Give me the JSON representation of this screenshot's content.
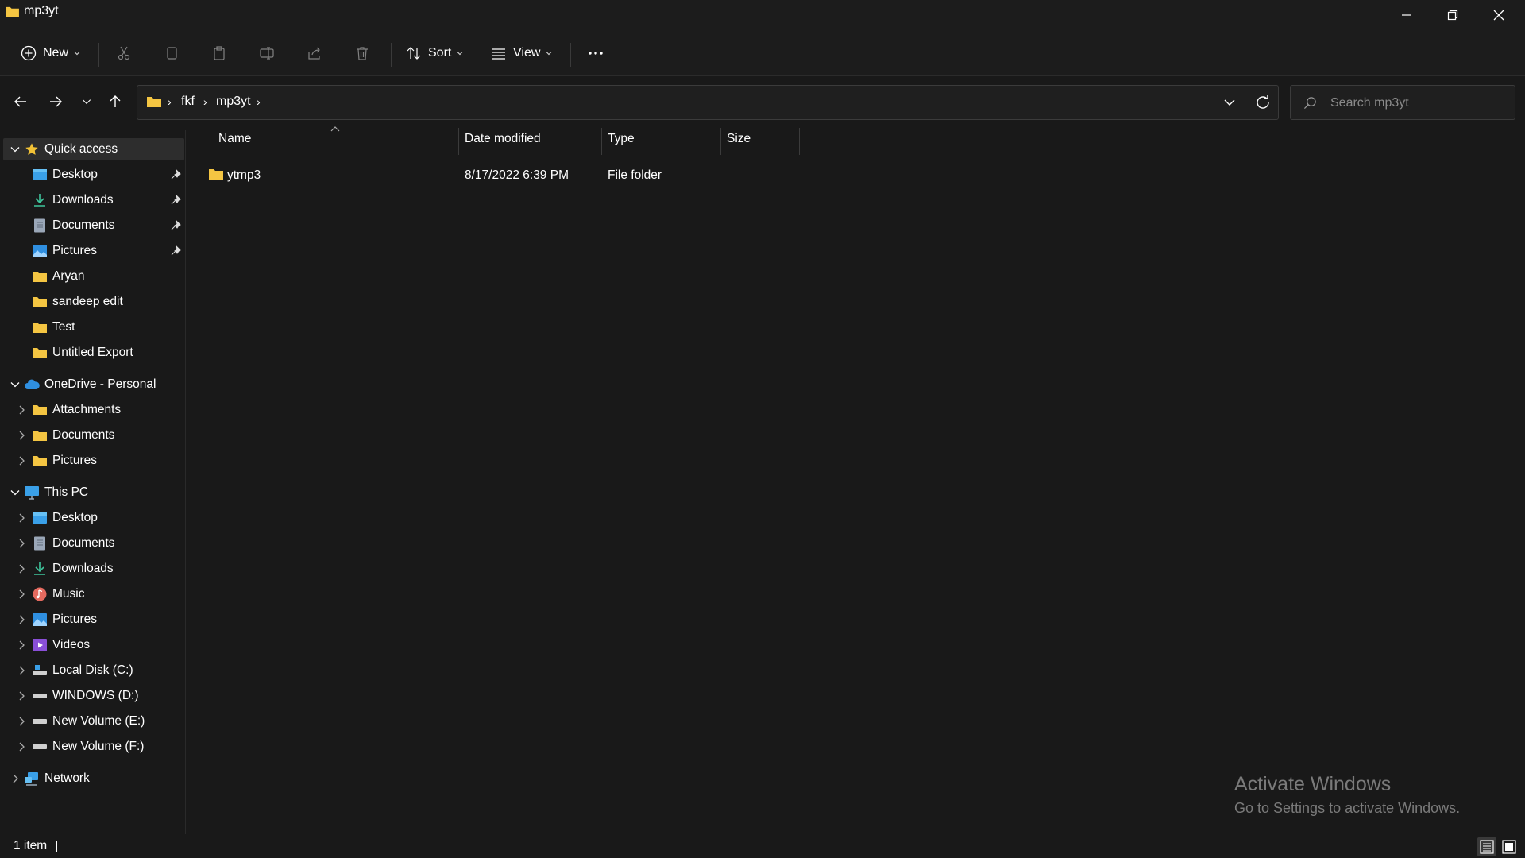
{
  "window": {
    "title": "mp3yt"
  },
  "toolbar": {
    "new_label": "New",
    "sort_label": "Sort",
    "view_label": "View"
  },
  "address": {
    "crumbs": [
      "fkf",
      "mp3yt"
    ]
  },
  "search": {
    "placeholder": "Search mp3yt"
  },
  "sidebar": {
    "quick_access": {
      "label": "Quick access",
      "items": [
        {
          "label": "Desktop",
          "icon": "desktop-icon",
          "pinned": true
        },
        {
          "label": "Downloads",
          "icon": "downloads-icon",
          "pinned": true
        },
        {
          "label": "Documents",
          "icon": "documents-icon",
          "pinned": true
        },
        {
          "label": "Pictures",
          "icon": "pictures-icon",
          "pinned": true
        },
        {
          "label": "Aryan",
          "icon": "folder-icon",
          "pinned": false
        },
        {
          "label": "sandeep edit",
          "icon": "folder-icon",
          "pinned": false
        },
        {
          "label": "Test",
          "icon": "folder-icon",
          "pinned": false
        },
        {
          "label": "Untitled Export",
          "icon": "folder-icon",
          "pinned": false
        }
      ]
    },
    "onedrive": {
      "label": "OneDrive - Personal",
      "items": [
        {
          "label": "Attachments",
          "icon": "folder-icon"
        },
        {
          "label": "Documents",
          "icon": "folder-icon"
        },
        {
          "label": "Pictures",
          "icon": "folder-icon"
        }
      ]
    },
    "this_pc": {
      "label": "This PC",
      "items": [
        {
          "label": "Desktop",
          "icon": "desktop-icon"
        },
        {
          "label": "Documents",
          "icon": "documents-icon"
        },
        {
          "label": "Downloads",
          "icon": "downloads-icon"
        },
        {
          "label": "Music",
          "icon": "music-icon"
        },
        {
          "label": "Pictures",
          "icon": "pictures-icon"
        },
        {
          "label": "Videos",
          "icon": "videos-icon"
        },
        {
          "label": "Local Disk (C:)",
          "icon": "system-drive-icon"
        },
        {
          "label": "WINDOWS (D:)",
          "icon": "drive-icon"
        },
        {
          "label": "New Volume (E:)",
          "icon": "drive-icon"
        },
        {
          "label": "New Volume (F:)",
          "icon": "drive-icon"
        }
      ]
    },
    "network": {
      "label": "Network"
    }
  },
  "columns": {
    "name": "Name",
    "date": "Date modified",
    "type": "Type",
    "size": "Size"
  },
  "files": [
    {
      "name": "ytmp3",
      "date": "8/17/2022 6:39 PM",
      "type": "File folder",
      "size": "",
      "icon": "folder-icon"
    }
  ],
  "status": {
    "count": "1 item"
  },
  "watermark": {
    "title": "Activate Windows",
    "subtitle": "Go to Settings to activate Windows."
  },
  "colors": {
    "folder": "#f4c542",
    "background": "#191919",
    "selected": "#2d2d2d"
  }
}
